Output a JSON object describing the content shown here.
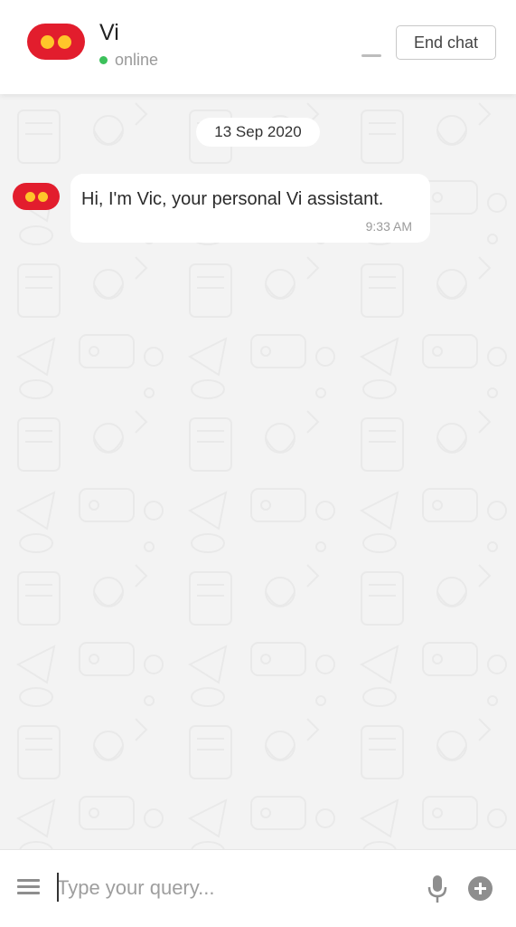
{
  "header": {
    "title": "Vi",
    "status": "online",
    "end_chat_label": "End chat"
  },
  "chat": {
    "date_label": "13 Sep 2020",
    "messages": [
      {
        "sender": "bot",
        "text": "Hi, I'm Vic, your personal Vi assistant.",
        "time": "9:33 AM"
      }
    ]
  },
  "input": {
    "placeholder": "Type your query..."
  },
  "colors": {
    "brand_red": "#e21d2d",
    "brand_yellow": "#ffc52a",
    "online_green": "#3cc15b",
    "background": "#f3f3f3"
  },
  "icons": {
    "logo": "vi-logo-icon",
    "minimize": "minimize-icon",
    "menu": "hamburger-menu-icon",
    "mic": "microphone-icon",
    "add": "plus-circle-icon"
  }
}
